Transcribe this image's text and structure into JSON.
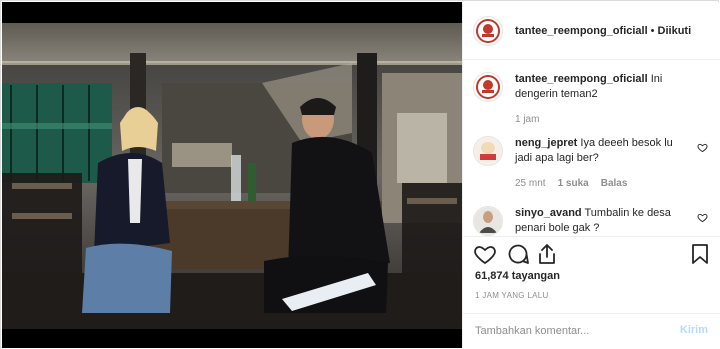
{
  "post": {
    "username": "tantee_reempong_oficiall",
    "separator": "•",
    "follow_label": "Diikuti"
  },
  "caption": {
    "username": "tantee_reempong_oficiall",
    "text": "Ini dengerin teman2",
    "time": "1 jam"
  },
  "comments": [
    {
      "username": "neng_jepret",
      "text": "Iya deeeh besok lu jadi apa lagi ber?",
      "time": "25 mnt",
      "likes": "1 suka",
      "reply_label": "Balas"
    },
    {
      "username": "sinyo_avand",
      "text": "Tumbalin ke desa penari bole gak ?"
    }
  ],
  "stats": {
    "views": "61,874 tayangan",
    "posted": "1 JAM YANG LALU"
  },
  "comment_box": {
    "placeholder": "Tambahkan komentar...",
    "post_label": "Kirim"
  },
  "icons": {
    "like": "heart-icon",
    "comment": "comment-icon",
    "share": "share-icon",
    "save": "bookmark-icon"
  }
}
